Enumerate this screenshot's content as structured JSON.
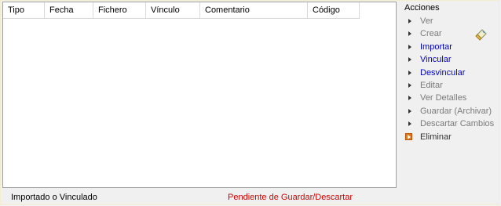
{
  "grid": {
    "columns": [
      "Tipo",
      "Fecha",
      "Fichero",
      "Vínculo",
      "Comentario",
      "Código"
    ]
  },
  "status": {
    "left": "Importado o Vinculado",
    "right": "Pendiente de Guardar/Descartar",
    "right_color": "#d40000"
  },
  "actions": {
    "title": "Acciones",
    "items": [
      {
        "label": "Ver",
        "state": "disabled"
      },
      {
        "label": "Crear",
        "state": "disabled"
      },
      {
        "label": "Importar",
        "state": "enabled"
      },
      {
        "label": "Vincular",
        "state": "enabled"
      },
      {
        "label": "Desvincular",
        "state": "enabled"
      },
      {
        "label": "Editar",
        "state": "disabled"
      },
      {
        "label": "Ver Detalles",
        "state": "disabled"
      },
      {
        "label": "Guardar (Archivar)",
        "state": "disabled"
      },
      {
        "label": "Descartar Cambios",
        "state": "disabled"
      },
      {
        "label": "Eliminar",
        "state": "danger",
        "icon": "delete-icon"
      }
    ]
  },
  "colors": {
    "enabled_link": "#0000cc",
    "disabled_text": "#7a7a7a",
    "background": "#f0f0f0"
  },
  "icons": {
    "side": "brush-icon"
  }
}
